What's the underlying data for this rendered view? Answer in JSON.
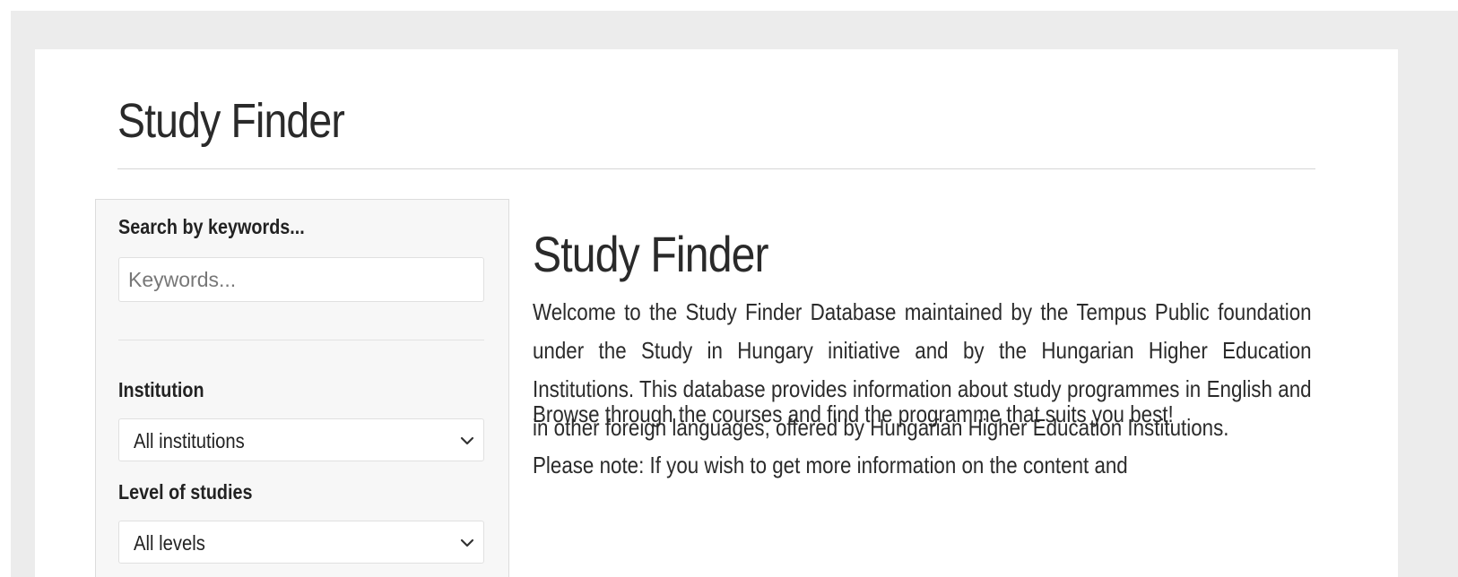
{
  "header": {
    "title": "Study Finder"
  },
  "sidebar": {
    "keywords_label": "Search by keywords...",
    "keywords_placeholder": "Keywords...",
    "institution_label": "Institution",
    "institution_value": "All institutions",
    "level_label": "Level of studies",
    "level_value": "All levels",
    "chevron_icon": "chevron-down-icon"
  },
  "main": {
    "title": "Study Finder",
    "intro": "Welcome to the Study Finder Database maintained by the Tempus Public foundation under the Study in Hungary initiative and by the Hungarian Higher Education Institutions. This database provides information about study programmes in English and in other foreign languages, offered by Hungarian Higher Education Institutions.",
    "browse": "Browse through the courses and find the programme that suits you best!",
    "partial": "Please note: If you wish to get more information on the content and"
  },
  "colors": {
    "card_background": "#ffffff",
    "sidebar_background": "#f7f7f7",
    "text": "#2b2b2b"
  }
}
